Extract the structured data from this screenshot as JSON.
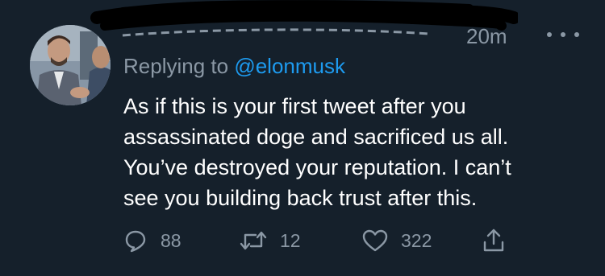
{
  "tweet": {
    "timestamp": "20m",
    "reply_prefix": "Replying to ",
    "reply_handle": "@elonmusk",
    "body_lines": [
      "As if this is your first tweet after you",
      "assassinated doge and sacrificed us all.",
      "You’ve destroyed your reputation. I can’t",
      "see you building back trust after this."
    ],
    "actions": {
      "reply": {
        "icon": "reply-icon",
        "count": "88"
      },
      "retweet": {
        "icon": "retweet-icon",
        "count": "12"
      },
      "like": {
        "icon": "heart-icon",
        "count": "322"
      },
      "share": {
        "icon": "share-icon"
      }
    },
    "more_icon": "more-dots-icon"
  },
  "colors": {
    "background": "#15202b",
    "muted_text": "#8b98a5",
    "link": "#1d9bf0",
    "body_text": "#ffffff"
  }
}
